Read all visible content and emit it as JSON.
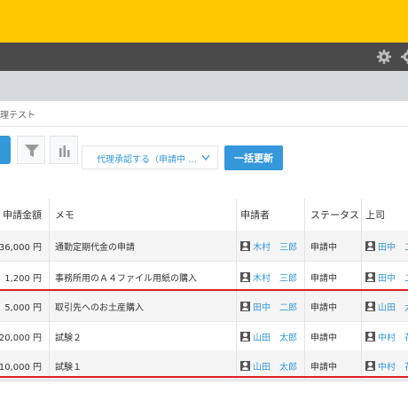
{
  "breadcrumb": "理テスト",
  "toolbar": {
    "proxy_select": "代理承認する（申請中 …",
    "bulk_update": "一括更新"
  },
  "table": {
    "headers": {
      "amount": "申請金額",
      "memo": "メモ",
      "applicant": "申請者",
      "status": "ステータス",
      "boss": "上司"
    },
    "rows": [
      {
        "amount": "36,000 円",
        "memo": "通勤定期代金の申請",
        "applicant": "木村　三郎",
        "status": "申請中",
        "boss": "田中　二"
      },
      {
        "amount": "1,200 円",
        "memo": "事務所用のＡ４ファイル用紙の購入",
        "applicant": "木村　三郎",
        "status": "申請中",
        "boss": "田中　二"
      },
      {
        "amount": "5,000 円",
        "memo": "取引先へのお土産購入",
        "applicant": "田中　二郎",
        "status": "申請中",
        "boss": "山田　太"
      },
      {
        "amount": "20,000 円",
        "memo": "試験２",
        "applicant": "山田　太郎",
        "status": "申請中",
        "boss": "中村　花"
      },
      {
        "amount": "10,000 円",
        "memo": "試験１",
        "applicant": "山田　太郎",
        "status": "申請中",
        "boss": "中村　花"
      }
    ]
  },
  "icons": {
    "settings": "gear-icon",
    "filter": "filter-icon",
    "graph": "bar-chart-icon",
    "user": "user-icon",
    "dropdown": "chevron-down-icon"
  },
  "colors": {
    "header": "#ffc800",
    "accent": "#3498db",
    "highlight": "#e02020"
  }
}
